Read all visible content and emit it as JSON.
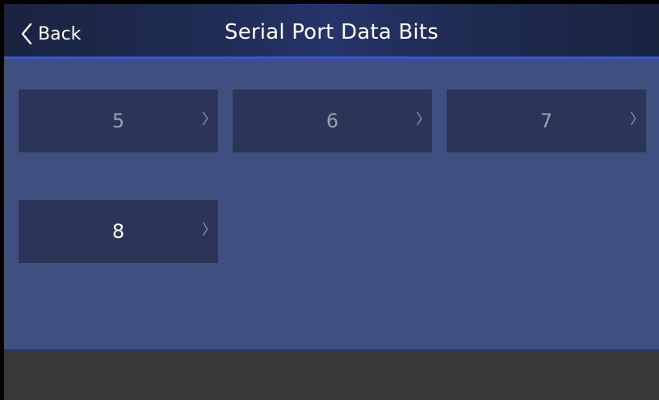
{
  "header": {
    "back_label": "Back",
    "title": "Serial Port Data Bits"
  },
  "options": [
    {
      "value": "5",
      "chevron": "〉",
      "selected": false
    },
    {
      "value": "6",
      "chevron": "〉",
      "selected": false
    },
    {
      "value": "7",
      "chevron": "〉",
      "selected": false
    },
    {
      "value": "8",
      "chevron": "〉",
      "selected": true
    }
  ],
  "icons": {
    "back": "chevron-left-icon",
    "option_arrow": "chevron-right-icon"
  },
  "colors": {
    "header_accent": "#3b57c6",
    "content_bg": "#3f4f80",
    "option_bg": "#2a3558",
    "selected_text": "#ffffff",
    "unselected_text": "#9aa0b2"
  }
}
